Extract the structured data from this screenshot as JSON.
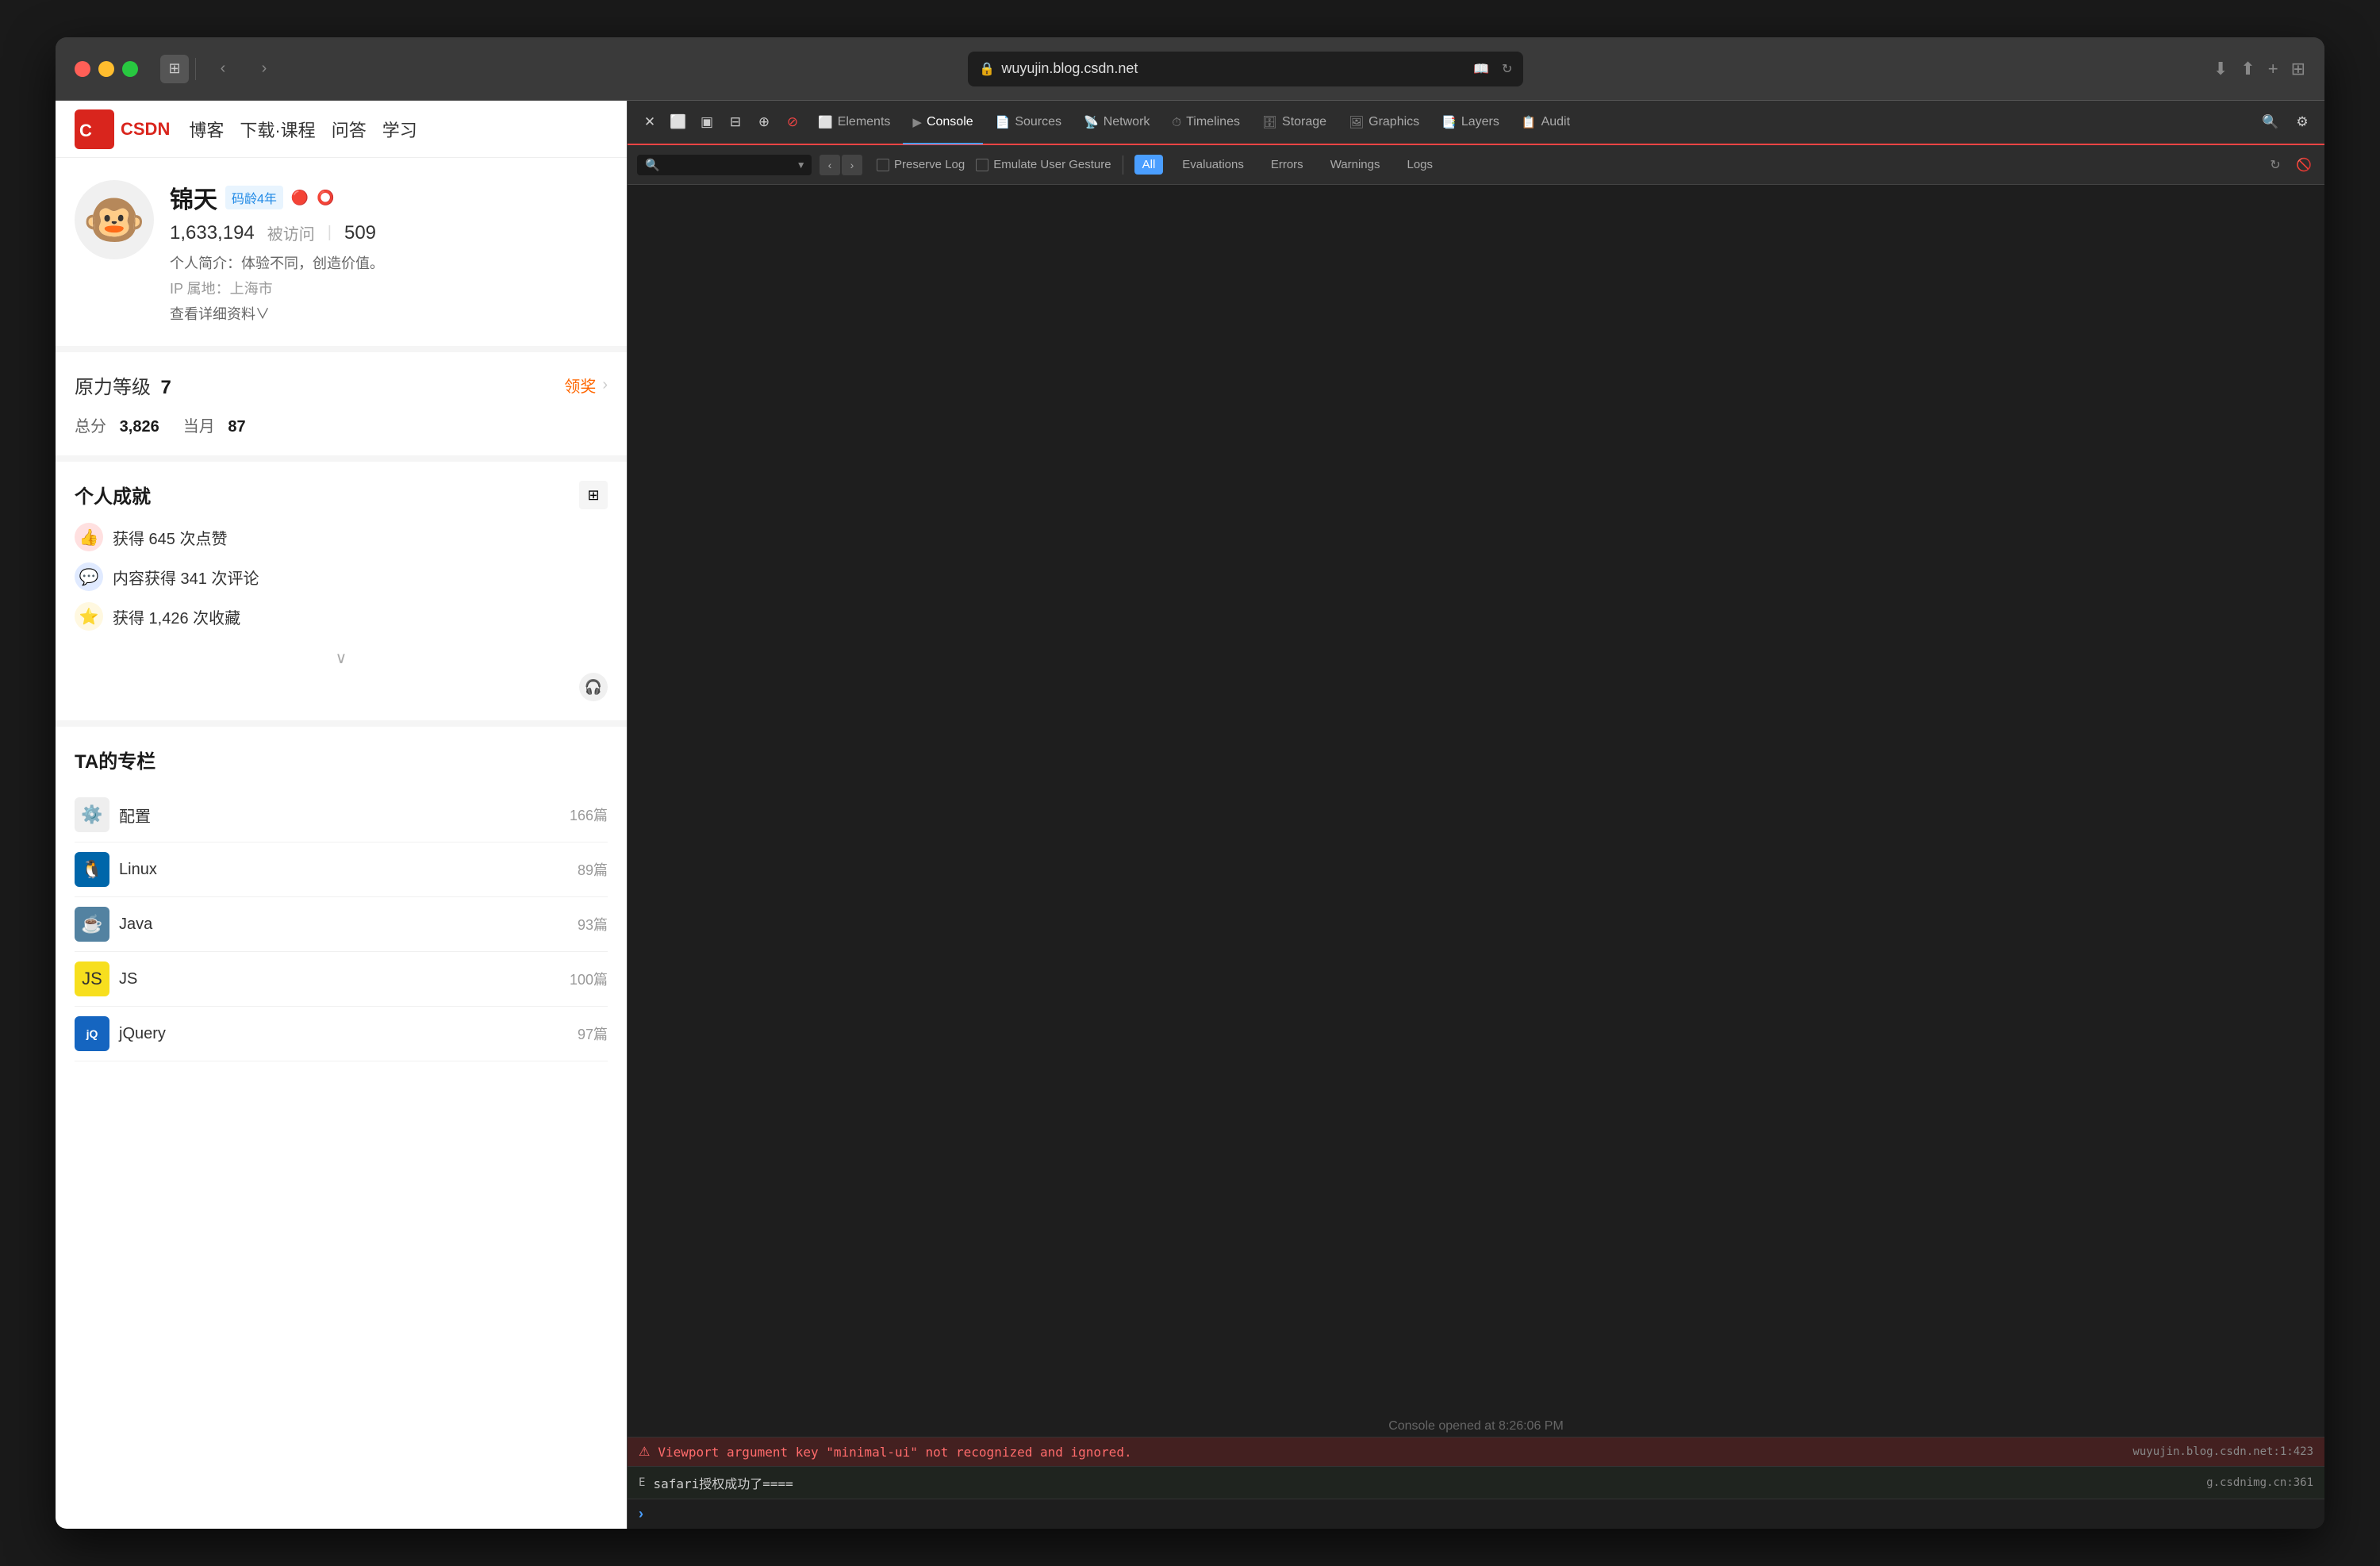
{
  "browser": {
    "title": "wuyujin.blog.csdn.net",
    "url": "wuyujin.blog.csdn.net",
    "lock_icon": "🔒"
  },
  "csdn": {
    "logo": "CSDN",
    "nav_items": [
      "博客",
      "下载·课程",
      "问答",
      "学习"
    ],
    "profile": {
      "name": "锦天",
      "badge_text": "码龄4年",
      "visits_count": "1,633,194",
      "visits_label": "被访问",
      "rank_num": "509",
      "bio": "个人简介：体验不同，创造价值。",
      "ip": "IP 属地：上海市",
      "detail_link": "查看详细资料∨"
    },
    "rank": {
      "title": "原力等级",
      "level": "7",
      "award_label": "领奖",
      "total_score_label": "总分",
      "total_score": "3,826",
      "monthly_label": "当月",
      "monthly_score": "87"
    },
    "achievement": {
      "title": "个人成就",
      "items": [
        {
          "label": "获得 645 次点赞"
        },
        {
          "label": "内容获得 341 次评论"
        },
        {
          "label": "获得 1,426 次收藏"
        }
      ]
    },
    "columns": {
      "title": "TA的专栏",
      "items": [
        {
          "name": "配置",
          "count": "166篇"
        },
        {
          "name": "Linux",
          "count": "89篇"
        },
        {
          "name": "Java",
          "count": "93篇"
        },
        {
          "name": "JS",
          "count": "100篇"
        },
        {
          "name": "jQuery",
          "count": "97篇"
        }
      ]
    }
  },
  "devtools": {
    "tabs": [
      {
        "label": "Elements",
        "icon": "⬜"
      },
      {
        "label": "Console",
        "icon": "▶",
        "active": true
      },
      {
        "label": "Sources",
        "icon": "📄"
      },
      {
        "label": "Network",
        "icon": "📡"
      },
      {
        "label": "Timelines",
        "icon": "⏱"
      },
      {
        "label": "Storage",
        "icon": "🗄"
      },
      {
        "label": "Graphics",
        "icon": "🖼"
      },
      {
        "label": "Layers",
        "icon": "📑"
      },
      {
        "label": "Audit",
        "icon": "📋"
      }
    ],
    "console": {
      "search_placeholder": "",
      "preserve_log": "Preserve Log",
      "emulate_gesture": "Emulate User Gesture",
      "filters": [
        "All",
        "Evaluations",
        "Errors",
        "Warnings",
        "Logs"
      ],
      "active_filter": "All",
      "opened_msg": "Console opened at 8:26:06 PM",
      "messages": [
        {
          "type": "error",
          "icon": "⚠",
          "text": "Viewport argument key \"minimal-ui\" not recognized and ignored.",
          "source": "wuyujin.blog.csdn.net:1:423"
        },
        {
          "type": "log",
          "icon": "E",
          "text": "safari授权成功了====",
          "source": "g.csdnimg.cn:361"
        },
        {
          "type": "prompt",
          "icon": ">",
          "text": "",
          "source": ""
        }
      ]
    }
  }
}
